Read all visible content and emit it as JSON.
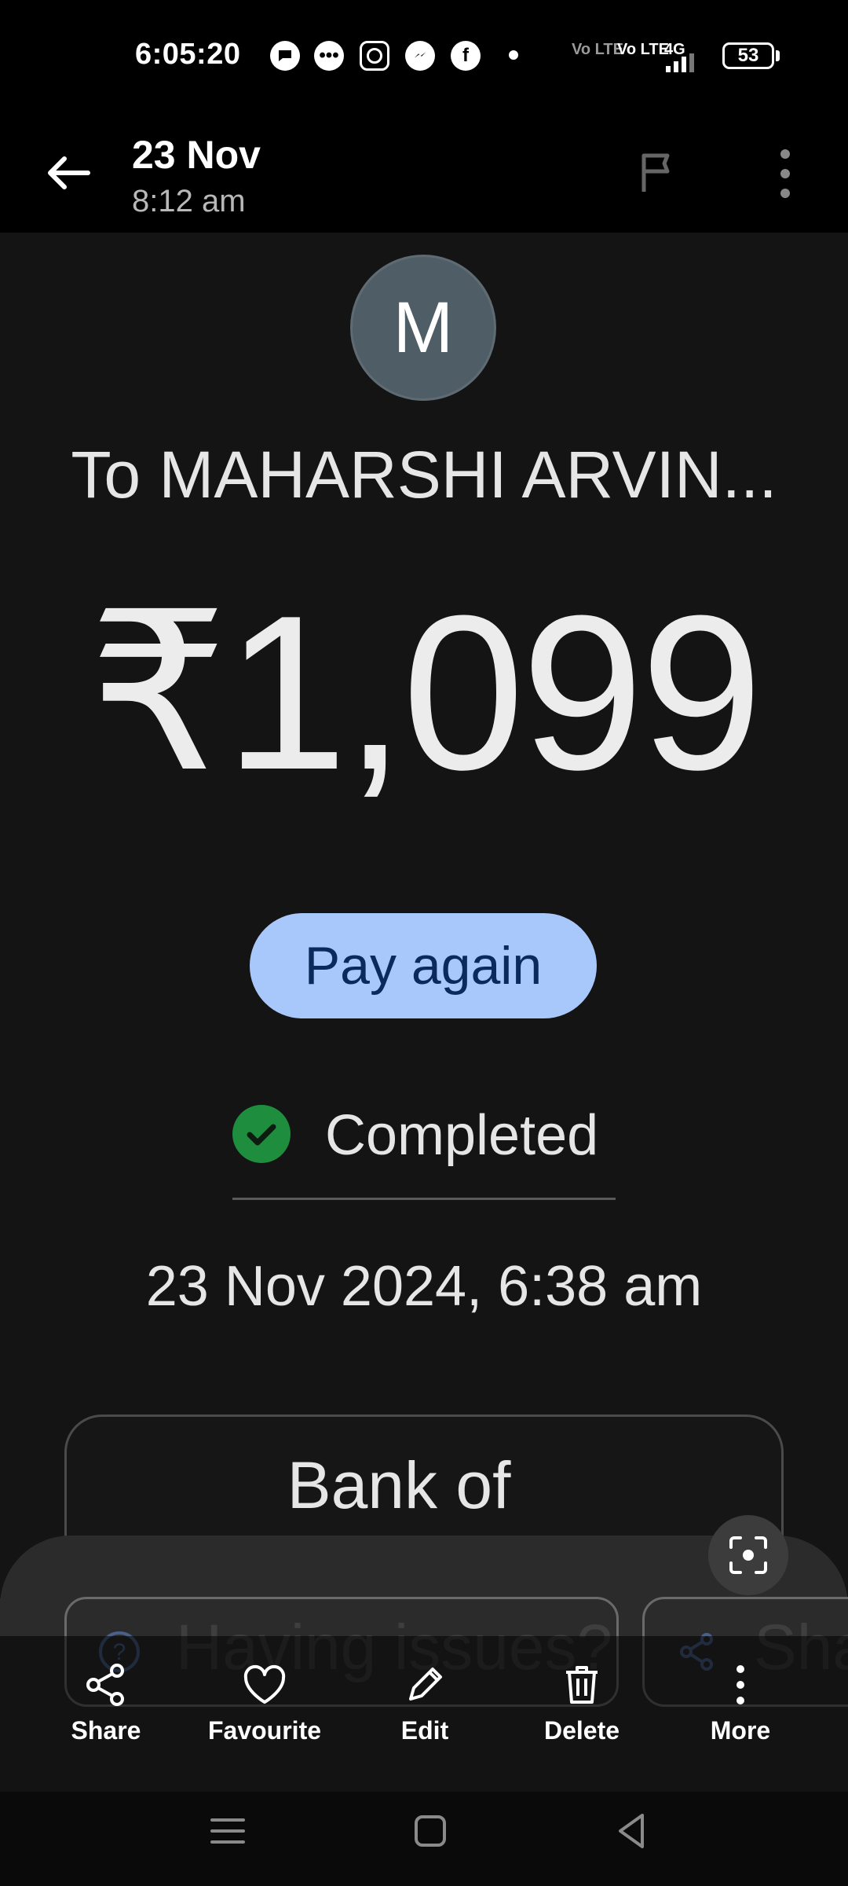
{
  "status_bar": {
    "time": "6:05:20",
    "battery": "53",
    "net1": "Vo LTE",
    "net2": "Vo LTE",
    "net3": "4G",
    "notification_icons": [
      "message-icon",
      "chat-bubble-icon",
      "instagram-icon",
      "messenger-icon",
      "facebook-icon",
      "dot-icon"
    ]
  },
  "header": {
    "date": "23 Nov",
    "time": "8:12 am"
  },
  "transaction": {
    "avatar_letter": "M",
    "payee": "To MAHARSHI ARVIN...",
    "amount": "₹1,099",
    "pay_again_label": "Pay again",
    "status": "Completed",
    "datetime": "23 Nov 2024, 6:38 am",
    "bank": "Bank of"
  },
  "sheet": {
    "chip1_label": "Having issues?",
    "chip2_label": "Sha"
  },
  "actions": [
    {
      "label": "Share"
    },
    {
      "label": "Favourite"
    },
    {
      "label": "Edit"
    },
    {
      "label": "Delete"
    },
    {
      "label": "More"
    }
  ],
  "colors": {
    "accent": "#a8c7fa",
    "success": "#1e8e3e",
    "background": "#141414"
  }
}
